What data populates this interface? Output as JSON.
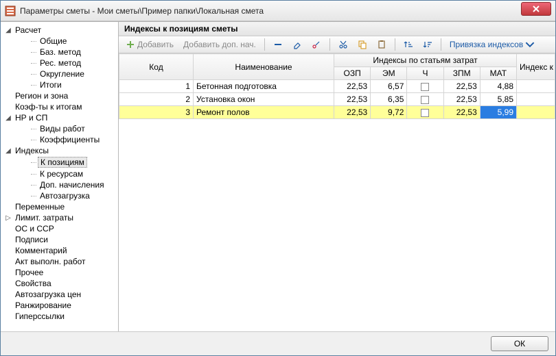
{
  "window": {
    "title": "Параметры сметы - Мои сметы\\Пример папки\\Локальная смета"
  },
  "sidebar": {
    "items": [
      {
        "label": "Расчет",
        "expanded": true,
        "level": 0
      },
      {
        "label": "Общие",
        "level": 1
      },
      {
        "label": "Баз. метод",
        "level": 1
      },
      {
        "label": "Рес. метод",
        "level": 1
      },
      {
        "label": "Округление",
        "level": 1
      },
      {
        "label": "Итоги",
        "level": 1
      },
      {
        "label": "Регион и зона",
        "level": 0
      },
      {
        "label": "Коэф-ты к итогам",
        "level": 0
      },
      {
        "label": "НР и СП",
        "expanded": true,
        "level": 0
      },
      {
        "label": "Виды работ",
        "level": 1
      },
      {
        "label": "Коэффициенты",
        "level": 1
      },
      {
        "label": "Индексы",
        "expanded": true,
        "level": 0
      },
      {
        "label": "К позициям",
        "level": 1,
        "selected": true
      },
      {
        "label": "К ресурсам",
        "level": 1
      },
      {
        "label": "Доп. начисления",
        "level": 1
      },
      {
        "label": "Автозагрузка",
        "level": 1
      },
      {
        "label": "Переменные",
        "level": 0
      },
      {
        "label": "Лимит. затраты",
        "expanded": false,
        "level": 0
      },
      {
        "label": "ОС и ССР",
        "level": 0
      },
      {
        "label": "Подписи",
        "level": 0
      },
      {
        "label": "Комментарий",
        "level": 0
      },
      {
        "label": "Акт выполн. работ",
        "level": 0
      },
      {
        "label": "Прочее",
        "level": 0
      },
      {
        "label": "Свойства",
        "level": 0
      },
      {
        "label": "Автозагрузка цен",
        "level": 0
      },
      {
        "label": "Ранжирование",
        "level": 0
      },
      {
        "label": "Гиперссылки",
        "level": 0
      }
    ]
  },
  "main": {
    "section_title": "Индексы к позициям сметы",
    "toolbar": {
      "add_label": "Добавить",
      "add_dop_label": "Добавить доп. нач.",
      "binding_label": "Привязка индексов"
    },
    "grid": {
      "headers": {
        "code": "Код",
        "name": "Наименование",
        "group": "Индексы по статьям затрат",
        "ozp": "ОЗП",
        "em": "ЭМ",
        "ch": "Ч",
        "zpm": "ЗПМ",
        "mat": "МАТ",
        "cmr": "Индекс к СМР"
      },
      "rows": [
        {
          "code": "1",
          "name": "Бетонная подготовка",
          "ozp": "22,53",
          "em": "6,57",
          "zpm": "22,53",
          "mat": "4,88",
          "cmr": ""
        },
        {
          "code": "2",
          "name": "Установка окон",
          "ozp": "22,53",
          "em": "6,35",
          "zpm": "22,53",
          "mat": "5,85",
          "cmr": ""
        },
        {
          "code": "3",
          "name": "Ремонт полов",
          "ozp": "22,53",
          "em": "9,72",
          "zpm": "22,53",
          "mat": "5,99",
          "cmr": "",
          "selected": true,
          "editing_mat": true
        }
      ]
    }
  },
  "footer": {
    "ok_label": "ОК"
  }
}
